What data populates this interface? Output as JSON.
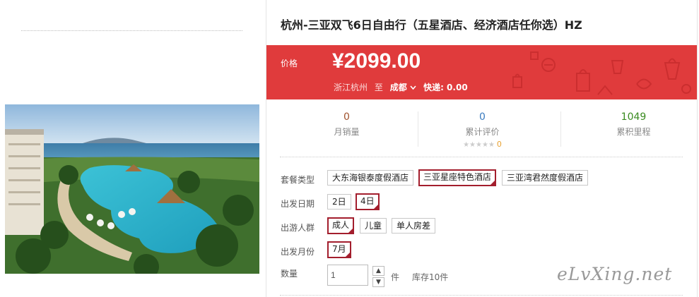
{
  "product": {
    "title": "杭州-三亚双飞6日自由行（五星酒店、经济酒店任你选）HZ"
  },
  "price": {
    "label": "价格",
    "value": "¥2099.00",
    "origin": "浙江杭州",
    "to": "至",
    "destination": "成都",
    "dropdown_icon": "chevron-down-icon",
    "shipping": "快递: 0.00"
  },
  "stats": {
    "monthly_sales": {
      "value": "0",
      "label": "月销量",
      "color": "#a0522d"
    },
    "reviews": {
      "value": "0",
      "label": "累计评价",
      "count": "0",
      "color": "#3a7bbf"
    },
    "points": {
      "value": "1049",
      "label": "累积里程",
      "color": "#3a8b20"
    }
  },
  "options": {
    "package": {
      "label": "套餐类型",
      "choices": [
        "大东海银泰度假酒店",
        "三亚星座特色酒店",
        "三亚湾君然度假酒店"
      ],
      "selected": "三亚星座特色酒店"
    },
    "date": {
      "label": "出发日期",
      "choices": [
        "2日",
        "4日"
      ],
      "selected": "4日"
    },
    "group": {
      "label": "出游人群",
      "choices": [
        "成人",
        "儿童",
        "单人房差"
      ],
      "selected": "成人"
    },
    "month": {
      "label": "出发月份",
      "choices": [
        "7月"
      ],
      "selected": "7月"
    }
  },
  "quantity": {
    "label": "数量",
    "value": "1",
    "unit": "件",
    "stock": "库存10件"
  },
  "watermark": "eLvXing.net",
  "colors": {
    "price_bar": "#e03b3c",
    "selected_border": "#a31e2d"
  }
}
